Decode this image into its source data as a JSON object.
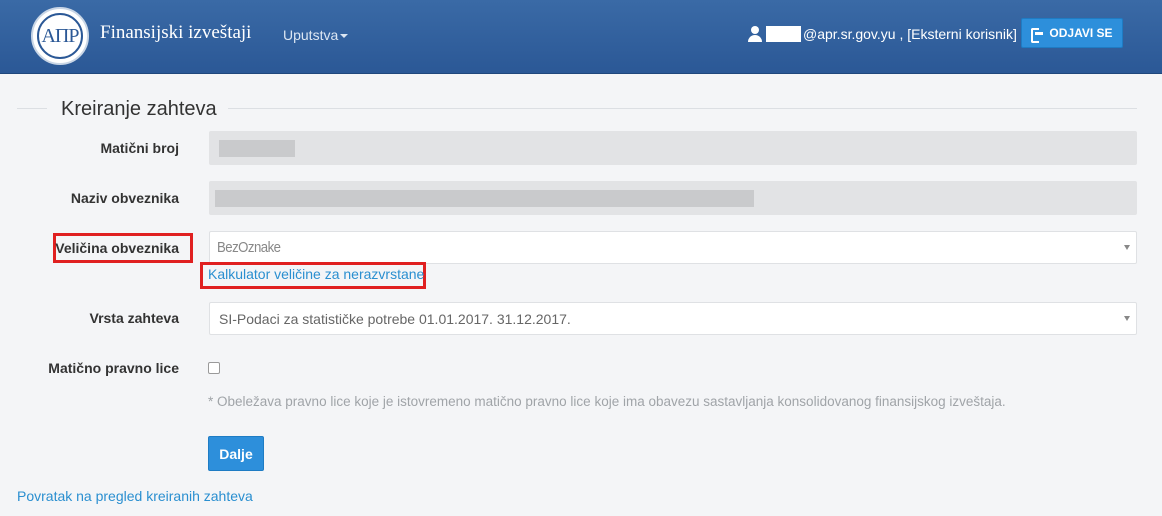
{
  "header": {
    "logo_text": "АПР",
    "brand": "Finansijski izveštaji",
    "nav_guides": "Uputstva",
    "user_suffix": "@apr.sr.gov.yu , [Eksterni korisnik]",
    "logout_label": "ODJAVI SE"
  },
  "form": {
    "title": "Kreiranje zahteva",
    "maticni_broj_label": "Matični broj",
    "naziv_label": "Naziv obveznika",
    "velicina_label": "Veličina obveznika",
    "velicina_value": "BezOznake",
    "calculator_link": "Kalkulator veličine za nerazvrstane",
    "vrsta_label": "Vrsta zahteva",
    "vrsta_value": "SI-Podaci za statističke potrebe 01.01.2017. 31.12.2017.",
    "maticno_pravno_label": "Matično pravno lice",
    "maticno_pravno_checked": false,
    "note": "* Obeležava pravno lice koje je istovremeno matično pravno lice koje ima obavezu sastavljanja konsolidovanog finansijskog izveštaja.",
    "next_button": "Dalje",
    "back_link": "Povratak na pregled kreiranih zahteva"
  },
  "colors": {
    "header_bg": "#2b5896",
    "accent": "#2d8fdb",
    "link": "#2a8fd0",
    "highlight": "#e02020"
  }
}
